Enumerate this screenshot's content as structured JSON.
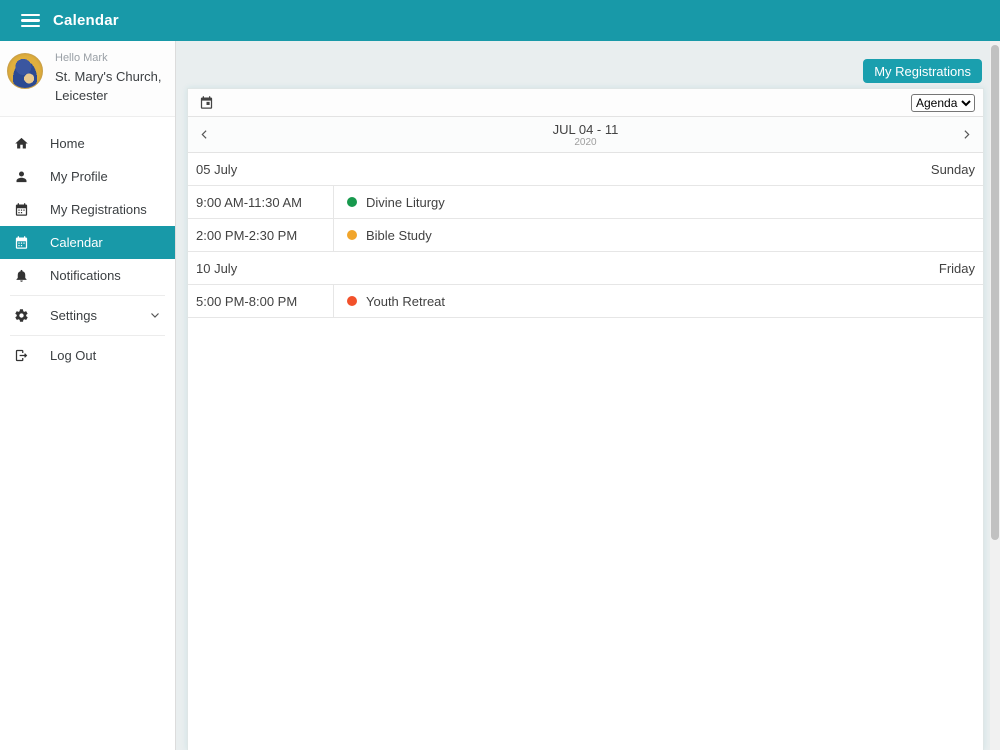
{
  "colors": {
    "teal": "#1899a8",
    "page_bg": "#e9eeef",
    "event_green": "#17994d",
    "event_amber": "#f1a52b",
    "event_red": "#f2512b"
  },
  "header": {
    "title": "Calendar"
  },
  "profile": {
    "greeting": "Hello Mark",
    "org_line1": "St. Mary's Church,",
    "org_line2": "Leicester"
  },
  "sidebar": {
    "items": [
      {
        "label": "Home"
      },
      {
        "label": "My Profile"
      },
      {
        "label": "My Registrations"
      },
      {
        "label": "Calendar"
      },
      {
        "label": "Notifications"
      },
      {
        "label": "Settings"
      },
      {
        "label": "Log Out"
      }
    ]
  },
  "main": {
    "registrations_button": "My Registrations",
    "view_select": {
      "value": "Agenda"
    },
    "nav": {
      "range": "JUL 04 - 11",
      "year": "2020"
    }
  },
  "agenda": {
    "groups": [
      {
        "date": "05 July",
        "day": "Sunday",
        "events": [
          {
            "time": "9:00 AM-11:30 AM",
            "title": "Divine Liturgy",
            "color": "#17994d"
          },
          {
            "time": "2:00 PM-2:30 PM",
            "title": "Bible Study",
            "color": "#f1a52b"
          }
        ]
      },
      {
        "date": "10 July",
        "day": "Friday",
        "events": [
          {
            "time": "5:00 PM-8:00 PM",
            "title": "Youth Retreat",
            "color": "#f2512b"
          }
        ]
      }
    ]
  }
}
